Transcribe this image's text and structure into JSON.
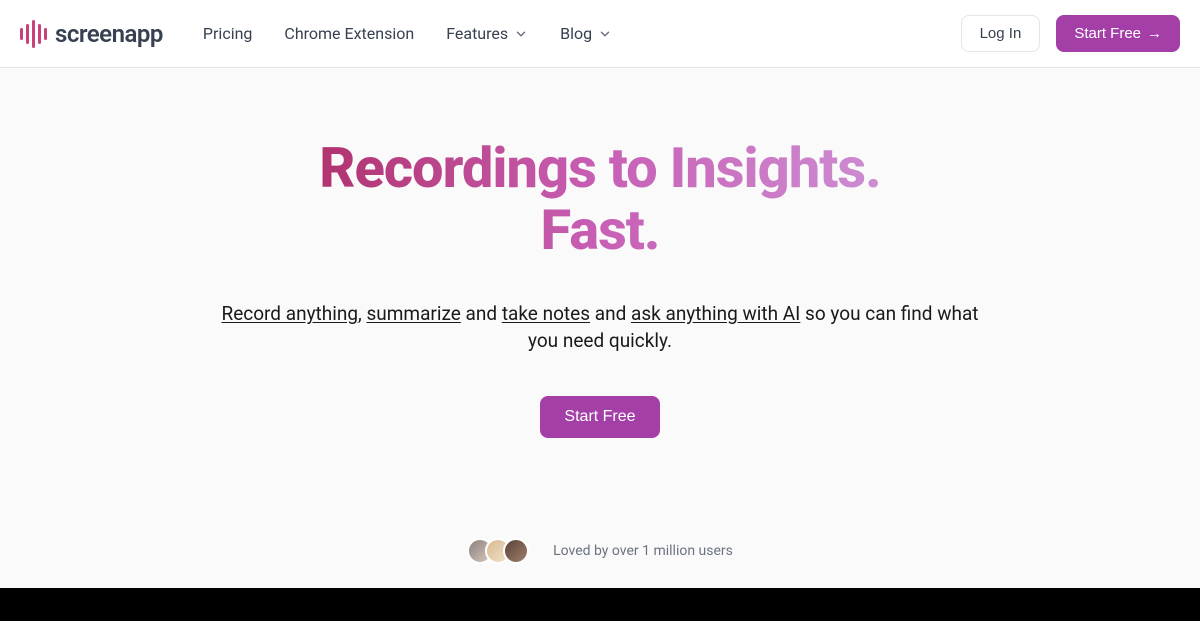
{
  "brand": {
    "name": "screenapp"
  },
  "nav": {
    "pricing": "Pricing",
    "chrome": "Chrome Extension",
    "features": "Features",
    "blog": "Blog"
  },
  "header": {
    "login": "Log In",
    "start_free": "Start Free",
    "arrow": "→"
  },
  "hero": {
    "title_line1": "Recordings to Insights.",
    "title_line2": "Fast.",
    "sub_link1": "Record anything",
    "sub_sep1": ", ",
    "sub_link2": "summarize",
    "sub_sep2": " and ",
    "sub_link3": "take notes",
    "sub_sep3": " and ",
    "sub_link4": "ask anything with AI",
    "sub_tail": " so you can find what you need quickly.",
    "cta": "Start Free"
  },
  "social": {
    "text": "Loved by over 1 million users"
  }
}
